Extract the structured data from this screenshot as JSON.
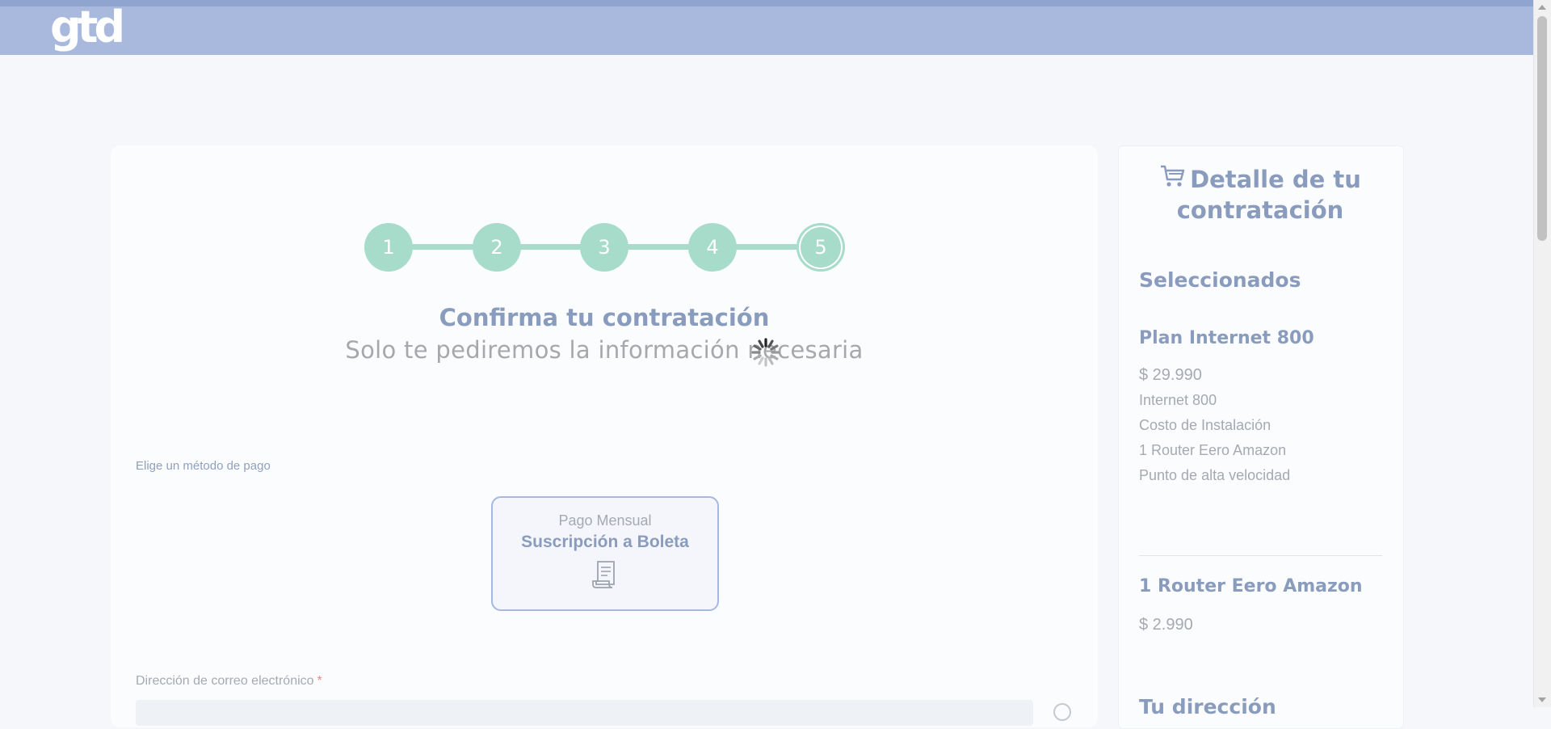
{
  "brand": {
    "logo_text": "gtd"
  },
  "stepper": {
    "steps": [
      "1",
      "2",
      "3",
      "4",
      "5"
    ],
    "active_step": "5"
  },
  "main": {
    "title": "Confirma tu contratación",
    "subtitle": "Solo te pediremos la información necesaria",
    "payment_method_label": "Elige un método de pago",
    "payment_option": {
      "top": "Pago Mensual",
      "main": "Suscripción a Boleta",
      "icon": "receipt-icon"
    },
    "email_label": "Dirección de correo electrónico",
    "email_required_mark": "*",
    "email_value": ""
  },
  "sidebar": {
    "title": "Detalle de tu contratación",
    "title_icon": "cart-icon",
    "selected_heading": "Seleccionados",
    "plan": {
      "name": "Plan Internet 800",
      "price": "$ 29.990",
      "items": [
        "Internet 800",
        "Costo de Instalación",
        "1 Router Eero Amazon",
        "Punto de alta velocidad"
      ]
    },
    "addon": {
      "name": "1 Router Eero Amazon",
      "price": "$ 2.990"
    },
    "address_heading": "Tu dirección"
  },
  "colors": {
    "header": "#a8b9dd",
    "stepper": "#a6dcc9",
    "heading": "#8a9cbd",
    "muted_text": "#a5a9b1"
  }
}
